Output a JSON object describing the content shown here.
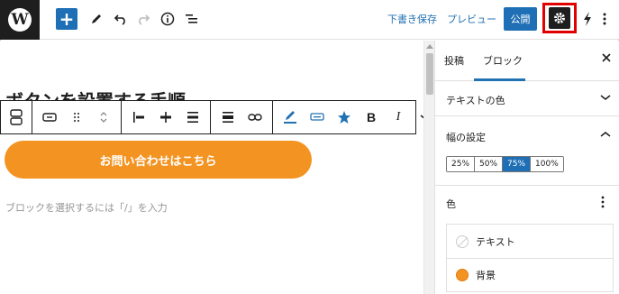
{
  "topbar": {
    "logo": "W",
    "add_label": "+",
    "draft_save": "下書き保存",
    "preview": "プレビュー",
    "publish": "公開"
  },
  "editor": {
    "heading": "ボタンを設置する手順",
    "cta_text": "お問い合わせはこちら",
    "placeholder": "ブロックを選択するには「/」を入力"
  },
  "sidebar": {
    "tabs": [
      "投稿",
      "ブロック"
    ],
    "active_tab": "ブロック",
    "panels": {
      "text_color": "テキストの色",
      "width_settings": "幅の設定",
      "color": "色"
    },
    "width_options": [
      "25%",
      "50%",
      "75%",
      "100%"
    ],
    "width_selected": "75%",
    "color_items": [
      {
        "label": "テキスト",
        "swatch": "none"
      },
      {
        "label": "背景",
        "swatch": "#f39422"
      }
    ]
  },
  "colors": {
    "accent": "#1e6fb5",
    "cta": "#f39422",
    "highlight": "#e00000"
  }
}
